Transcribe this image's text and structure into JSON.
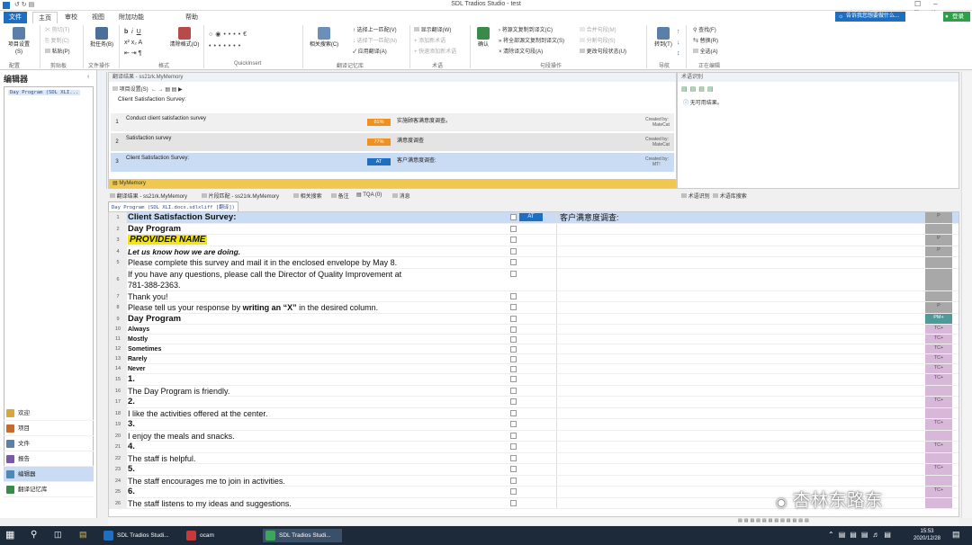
{
  "window": {
    "title": "SDL Tradios Studio - test"
  },
  "menu": [
    "文件",
    "主页",
    "审校",
    "视图",
    "附加功能",
    "帮助"
  ],
  "search_box": "告诉我您想要做什么...",
  "login": "登录",
  "ribbon": {
    "groups": [
      "配置",
      "剪贴板",
      "文件操作",
      "格式",
      "QuickInsert",
      "翻译记忆库",
      "术语",
      "句段操作",
      "导航",
      "正在编辑"
    ],
    "project_settings": "项目设置(S)",
    "cut": "剪切(T)",
    "copy": "复制(C)",
    "paste": "粘贴(P)",
    "batch_tasks": "批任务(B)",
    "clear_format": "清除格式(O)",
    "related_search": "相关搜索(C)",
    "apply_prev": "选择上一匹配(V)",
    "apply_next": "选择下一匹配(N)",
    "apply_translation": "应用翻译(A)",
    "show_translation": "显示翻译(W)",
    "add_term": "添加新术语",
    "quick_add_term": "快速添加新术语",
    "confirm": "确认",
    "copy_source": "将源文复制到译文(C)",
    "copy_all_source": "将全部源文复制到译文(S)",
    "clear_target": "清除译文句段(A)",
    "merge": "合并句段(M)",
    "split": "分割句段(S)",
    "change_status": "更改句段状态(U)",
    "goto": "转到(T)",
    "find": "查找(F)",
    "replace": "替换(R)",
    "select_all": "全选(A)"
  },
  "left": {
    "title": "编辑器",
    "file_node": "Day Program (SDL XLI...",
    "nav": [
      "欢迎",
      "项目",
      "文件",
      "报告",
      "编辑器",
      "翻译记忆库"
    ]
  },
  "tm": {
    "header": "翻译结果 - ss21rk.MyMemory",
    "toolbar": "项目设置(S)",
    "source_line": "Client Satisfaction Survey:",
    "rows": [
      {
        "num": "1",
        "src": "Conduct client satisfaction survey",
        "pct": "81%",
        "tgt": "实施顾客满意度调查。",
        "meta1": "Created by:",
        "meta2": "MateCat"
      },
      {
        "num": "2",
        "src": "Satisfaction survey",
        "pct": "77%",
        "tgt": "满意度调查",
        "meta1": "Created by:",
        "meta2": "MateCat"
      },
      {
        "num": "3",
        "src": "Client Satisfaction Survey:",
        "pct": "AT",
        "tgt": "客户满意度调查:",
        "meta1": "Created by:",
        "meta2": "MT!"
      }
    ],
    "footer": "MyMemory"
  },
  "term": {
    "header": "术语识别",
    "empty": "无可用结果。",
    "footer1": "术语识别",
    "footer2": "术语库搜索"
  },
  "editor_tabs": [
    "翻译结果 - ss21rk.MyMemory",
    "片段匹配 - ss21rk.MyMemory",
    "相关搜索",
    "备注",
    "TQA (0)",
    "消息"
  ],
  "file_tab": "Day Program (SDL XLI.docx.sdlxliff [翻译])",
  "segments": [
    {
      "n": "1",
      "text": "Client Satisfaction Survey:",
      "style": "bold",
      "status": "AT",
      "target": "客户满意度调查:",
      "p": "P",
      "pc": "#a8a8a8",
      "sel": true
    },
    {
      "n": "2",
      "text": "Day Program",
      "style": "bold",
      "status": "",
      "target": "",
      "p": "",
      "pc": "#a8a8a8"
    },
    {
      "n": "3",
      "text": "PROVIDER NAME",
      "style": "hl",
      "status": "",
      "target": "",
      "p": "P",
      "pc": "#a8a8a8"
    },
    {
      "n": "4",
      "text": "Let us know how we are doing.",
      "style": "bi",
      "status": "",
      "target": "",
      "p": "P",
      "pc": "#a8a8a8"
    },
    {
      "n": "5",
      "text": "Please complete this survey and mail it in the enclosed envelope by May 8.",
      "style": "",
      "status": "",
      "target": "",
      "p": "",
      "pc": "#a8a8a8"
    },
    {
      "n": "6",
      "text": "If you have any questions, please call the Director of Quality Improvement at",
      "text2": "781-388-2363.",
      "style": "",
      "status": "",
      "target": "",
      "p": "",
      "pc": "#a8a8a8",
      "tall": true
    },
    {
      "n": "7",
      "text": "Thank you!",
      "style": "",
      "status": "",
      "target": "",
      "p": "",
      "pc": "#a8a8a8"
    },
    {
      "n": "8",
      "text": "Please tell us your response by",
      "text_b": "writing an “X”",
      "text_c": " in the desired column.",
      "style": "mixed",
      "status": "",
      "target": "",
      "p": "P",
      "pc": "#a8a8a8"
    },
    {
      "n": "9",
      "text": "Day Program",
      "style": "bold",
      "status": "",
      "target": "",
      "p": "PM+",
      "pc": "#4e9a9a"
    },
    {
      "n": "10",
      "text": "Always",
      "style": "bsmall",
      "status": "",
      "target": "",
      "p": "TC+",
      "pc": "#d8b8d8"
    },
    {
      "n": "11",
      "text": "Mostly",
      "style": "bsmall",
      "status": "",
      "target": "",
      "p": "TC+",
      "pc": "#d8b8d8"
    },
    {
      "n": "12",
      "text": "Sometimes",
      "style": "bsmall",
      "status": "",
      "target": "",
      "p": "TC+",
      "pc": "#d8b8d8"
    },
    {
      "n": "13",
      "text": "Rarely",
      "style": "bsmall",
      "status": "",
      "target": "",
      "p": "TC+",
      "pc": "#d8b8d8"
    },
    {
      "n": "14",
      "text": "Never",
      "style": "bsmall",
      "status": "",
      "target": "",
      "p": "TC+",
      "pc": "#d8b8d8"
    },
    {
      "n": "15",
      "text": "1.",
      "style": "bold",
      "status": "",
      "target": "",
      "p": "TC+",
      "pc": "#d8b8d8"
    },
    {
      "n": "16",
      "text": "The Day Program is friendly.",
      "style": "",
      "status": "",
      "target": "",
      "p": "",
      "pc": "#d8b8d8"
    },
    {
      "n": "17",
      "text": "2.",
      "style": "bold",
      "status": "",
      "target": "",
      "p": "TC+",
      "pc": "#d8b8d8"
    },
    {
      "n": "18",
      "text": "I like the activities offered at the center.",
      "style": "",
      "status": "",
      "target": "",
      "p": "",
      "pc": "#d8b8d8"
    },
    {
      "n": "19",
      "text": "3.",
      "style": "bold",
      "status": "",
      "target": "",
      "p": "TC+",
      "pc": "#d8b8d8"
    },
    {
      "n": "20",
      "text": "I enjoy the meals and snacks.",
      "style": "",
      "status": "",
      "target": "",
      "p": "",
      "pc": "#d8b8d8"
    },
    {
      "n": "21",
      "text": "4.",
      "style": "bold",
      "status": "",
      "target": "",
      "p": "TC+",
      "pc": "#d8b8d8"
    },
    {
      "n": "22",
      "text": "The staff is helpful.",
      "style": "",
      "status": "",
      "target": "",
      "p": "",
      "pc": "#d8b8d8"
    },
    {
      "n": "23",
      "text": "5.",
      "style": "bold",
      "status": "",
      "target": "",
      "p": "TC+",
      "pc": "#d8b8d8"
    },
    {
      "n": "24",
      "text": "The staff encourages me to join in activities.",
      "style": "",
      "status": "",
      "target": "",
      "p": "",
      "pc": "#d8b8d8"
    },
    {
      "n": "25",
      "text": "6.",
      "style": "bold",
      "status": "",
      "target": "",
      "p": "TC+",
      "pc": "#d8b8d8"
    },
    {
      "n": "26",
      "text": "The staff listens to my ideas and suggestions.",
      "style": "",
      "status": "",
      "target": "",
      "p": "",
      "pc": "#d8b8d8"
    }
  ],
  "taskbar": {
    "items": [
      "SDL Tradios Studi...",
      "ocam",
      "SDL Tradios Studi..."
    ],
    "time": "15:53",
    "date": "2020/12/28"
  },
  "watermark": "杏林东路东",
  "colors": {
    "accent": "#1e6fc2",
    "pct_orange": "#f0901e",
    "at_blue": "#1e6fc2",
    "selected_row": "#c9dcf3",
    "footer_yellow": "#f0c850"
  }
}
